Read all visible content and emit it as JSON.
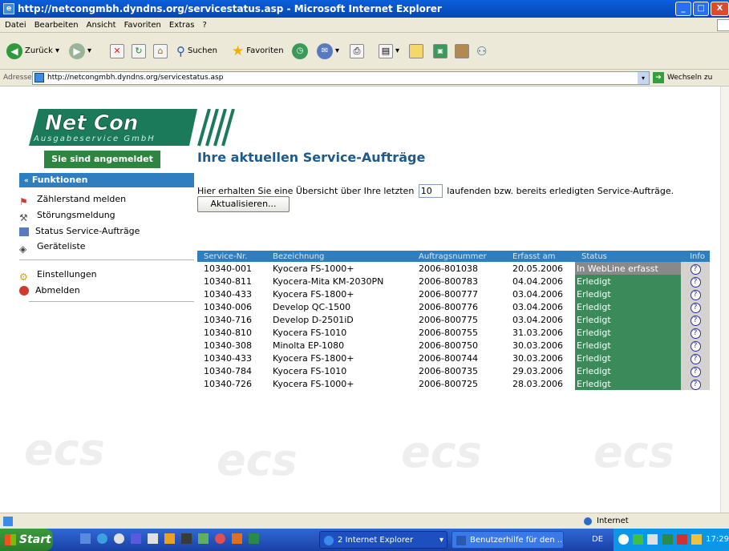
{
  "window": {
    "title": "http://netcongmbh.dyndns.org/servicestatus.asp - Microsoft Internet Explorer"
  },
  "menu": [
    "Datei",
    "Bearbeiten",
    "Ansicht",
    "Favoriten",
    "Extras",
    "?"
  ],
  "toolbar": {
    "back": "Zurück",
    "search": "Suchen",
    "favorites": "Favoriten"
  },
  "address": {
    "label": "Adresse",
    "url": "http://netcongmbh.dyndns.org/servicestatus.asp",
    "go": "Wechseln zu"
  },
  "logo": {
    "name": "Net Con",
    "sub": "Ausgabeservice GmbH"
  },
  "watermark": "ecs",
  "sidebar": {
    "status_badge": "Sie sind angemeldet",
    "section": "Funktionen",
    "items": [
      "Zählerstand melden",
      "Störungsmeldung",
      "Status Service-Aufträge",
      "Geräteliste"
    ],
    "items2": [
      "Einstellungen",
      "Abmelden"
    ]
  },
  "main": {
    "title": "Ihre aktuellen Service-Aufträge",
    "intro_before": "Hier erhalten Sie eine Übersicht über Ihre letzten",
    "count": "10",
    "intro_after": "laufenden bzw. bereits erledigten Service-Aufträge.",
    "refresh": "Aktualisieren..."
  },
  "table": {
    "columns": [
      "Service-Nr.",
      "Bezeichnung",
      "Auftragsnummer",
      "Erfasst am",
      "Status",
      "Info"
    ],
    "rows": [
      [
        "10340-001",
        "Kyocera FS-1000+",
        "2006-801038",
        "20.05.2006",
        "In WebLine erfasst"
      ],
      [
        "10340-811",
        "Kyocera-Mita KM-2030PN",
        "2006-800783",
        "04.04.2006",
        "Erledigt"
      ],
      [
        "10340-433",
        "Kyocera FS-1800+",
        "2006-800777",
        "03.04.2006",
        "Erledigt"
      ],
      [
        "10340-006",
        "Develop QC-1500",
        "2006-800776",
        "03.04.2006",
        "Erledigt"
      ],
      [
        "10340-716",
        "Develop D-2501iD",
        "2006-800775",
        "03.04.2006",
        "Erledigt"
      ],
      [
        "10340-810",
        "Kyocera FS-1010",
        "2006-800755",
        "31.03.2006",
        "Erledigt"
      ],
      [
        "10340-308",
        "Minolta EP-1080",
        "2006-800750",
        "30.03.2006",
        "Erledigt"
      ],
      [
        "10340-433",
        "Kyocera FS-1800+",
        "2006-800744",
        "30.03.2006",
        "Erledigt"
      ],
      [
        "10340-784",
        "Kyocera FS-1010",
        "2006-800735",
        "29.03.2006",
        "Erledigt"
      ],
      [
        "10340-726",
        "Kyocera FS-1000+",
        "2006-800725",
        "28.03.2006",
        "Erledigt"
      ]
    ]
  },
  "statusbar": {
    "zone": "Internet"
  },
  "taskbar": {
    "start": "Start",
    "tasks": [
      "2 Internet Explorer",
      "Benutzerhilfe für den ..."
    ],
    "lang": "DE",
    "clock": "17:29"
  },
  "colors": {
    "accent": "#2f7ec0",
    "done": "#3a8a5a",
    "open": "#898989",
    "badge": "#2e8540",
    "title": "#1f5a8a"
  }
}
